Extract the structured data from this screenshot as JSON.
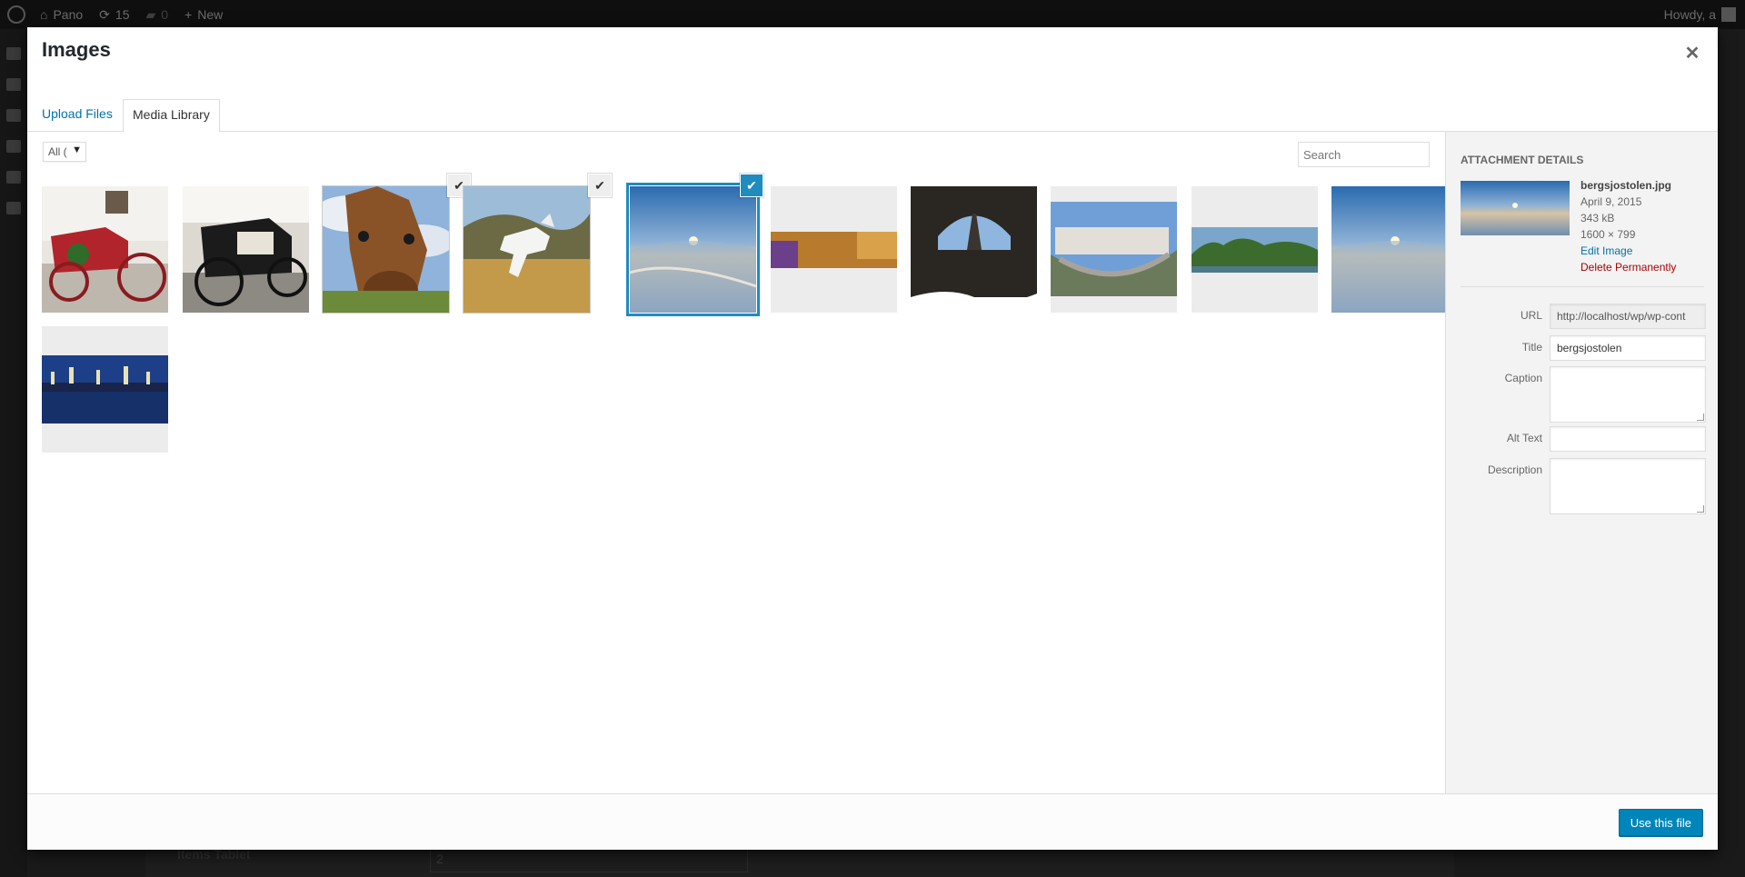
{
  "adminbar": {
    "site_name": "Pano",
    "updates_count": "15",
    "comments_count": "0",
    "new_label": "New",
    "howdy": "Howdy, a"
  },
  "background": {
    "field_label": "Items Tablet",
    "field_value": "2"
  },
  "modal": {
    "title": "Images",
    "tabs": [
      "Upload Files",
      "Media Library"
    ],
    "active_tab": "Media Library",
    "filter_label": "All (",
    "search_placeholder": "Search",
    "use_button": "Use this file"
  },
  "attachments": [
    {
      "name": "red carriage",
      "selected": false
    },
    {
      "name": "black carriage",
      "selected": false
    },
    {
      "name": "horse closeup",
      "selected": true
    },
    {
      "name": "white horse",
      "selected": true
    },
    {
      "name": "bergsjostolen",
      "selected": true,
      "focused": true
    },
    {
      "name": "room panorama",
      "selected": false
    },
    {
      "name": "tunnel eiffel",
      "selected": false
    },
    {
      "name": "street panorama",
      "selected": false
    },
    {
      "name": "river panorama",
      "selected": false
    },
    {
      "name": "bergsjostolen copy",
      "selected": false
    },
    {
      "name": "city night",
      "selected": false
    }
  ],
  "details": {
    "heading": "Attachment Details",
    "filename": "bergsjostolen.jpg",
    "date": "April 9, 2015",
    "size": "343 kB",
    "dimensions": "1600 × 799",
    "edit_link": "Edit Image",
    "delete_link": "Delete Permanently",
    "fields": {
      "url_label": "URL",
      "url_value": "http://localhost/wp/wp-cont",
      "title_label": "Title",
      "title_value": "bergsjostolen",
      "caption_label": "Caption",
      "caption_value": "",
      "alt_label": "Alt Text",
      "alt_value": "",
      "description_label": "Description",
      "description_value": ""
    }
  },
  "colors": {
    "accent": "#1e8cbe",
    "button": "#0085ba",
    "link": "#0073aa",
    "delete": "#a00000"
  }
}
